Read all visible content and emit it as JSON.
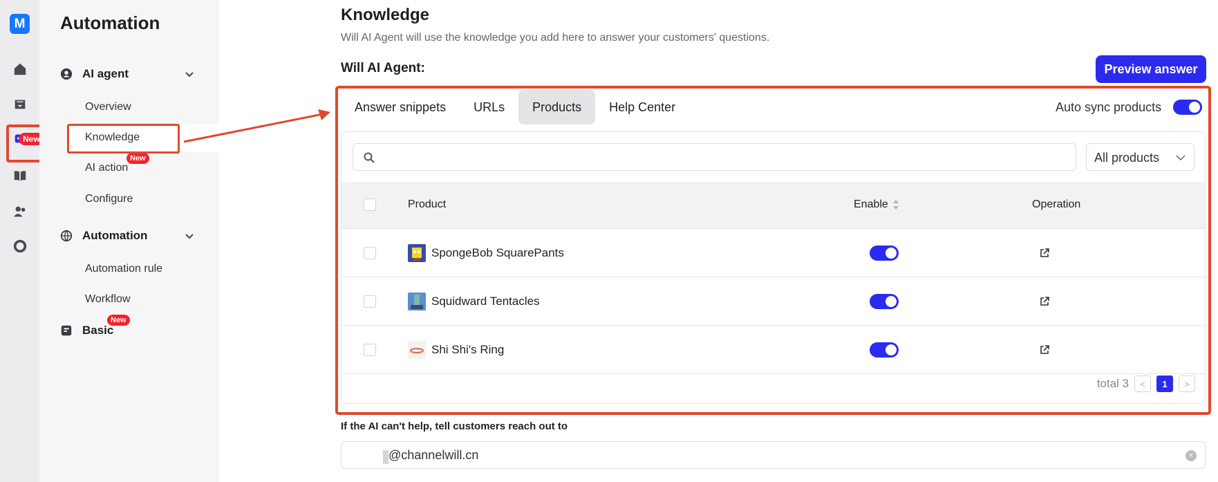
{
  "rail": {
    "logo": "M",
    "new_badge": "New",
    "icons": [
      "home-icon",
      "inbox-icon",
      "bot-icon",
      "book-icon",
      "users-icon",
      "chart-icon"
    ]
  },
  "sidebar": {
    "title": "Automation",
    "groups": [
      {
        "label": "AI agent",
        "icon": "user-circle-icon"
      },
      {
        "label": "Automation",
        "icon": "globe-icon"
      },
      {
        "label": "Basic",
        "icon": "note-icon"
      }
    ],
    "items": {
      "overview": "Overview",
      "knowledge": "Knowledge",
      "ai_action": "AI action",
      "configure": "Configure",
      "automation_rule": "Automation rule",
      "workflow": "Workflow"
    },
    "badge": "New"
  },
  "main": {
    "title": "Knowledge",
    "description": "Will AI Agent will use the knowledge you add here to answer your customers' questions.",
    "agent_label": "Will AI Agent:",
    "preview_button": "Preview answer",
    "tabs": [
      "Answer snippets",
      "URLs",
      "Products",
      "Help Center"
    ],
    "active_tab": "Products",
    "auto_sync_label": "Auto sync products",
    "auto_sync": true,
    "search": {
      "placeholder": "",
      "value": ""
    },
    "filter": {
      "selected": "All products"
    },
    "table": {
      "columns": [
        "Product",
        "Enable",
        "Operation"
      ],
      "rows": [
        {
          "name": "SpongeBob SquarePants",
          "enabled": true
        },
        {
          "name": "Squidward Tentacles",
          "enabled": true
        },
        {
          "name": "Shi Shi's Ring",
          "enabled": true
        }
      ]
    },
    "pagination": {
      "total_label": "total 3",
      "current_page": "1",
      "prev": "<",
      "next": ">"
    },
    "fallback": {
      "label": "If the AI can't help, tell customers reach out to",
      "email_value": "@channelwill.cn"
    }
  },
  "colors": {
    "accent": "#2b2bf0",
    "annotation": "#e04a2c",
    "badge": "#f5222d"
  }
}
